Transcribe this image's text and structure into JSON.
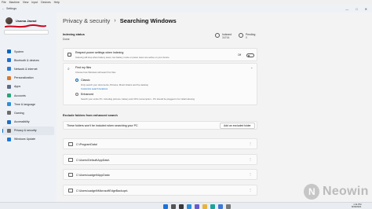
{
  "vm_menu": [
    "File",
    "Machine",
    "View",
    "Input",
    "Devices",
    "Help"
  ],
  "window": {
    "title": "Settings",
    "back_icon": "arrow-left-icon",
    "minimize": "—",
    "maximize": "□",
    "close": "✕"
  },
  "user": {
    "name": "Usama Jawad"
  },
  "sidebar": {
    "items": [
      {
        "label": "System",
        "icon": "monitor-icon",
        "color": "#0067c0"
      },
      {
        "label": "Bluetooth & devices",
        "icon": "bluetooth-icon",
        "color": "#1f6fd1"
      },
      {
        "label": "Network & internet",
        "icon": "network-icon",
        "color": "#2b7ad8"
      },
      {
        "label": "Personalization",
        "icon": "brush-icon",
        "color": "#d9782d"
      },
      {
        "label": "Apps",
        "icon": "apps-icon",
        "color": "#5b6b8a"
      },
      {
        "label": "Accounts",
        "icon": "person-icon",
        "color": "#2aa37a"
      },
      {
        "label": "Time & language",
        "icon": "globe-icon",
        "color": "#2d8fd8"
      },
      {
        "label": "Gaming",
        "icon": "gamepad-icon",
        "color": "#6c6c6c"
      },
      {
        "label": "Accessibility",
        "icon": "accessibility-icon",
        "color": "#1d6fc7"
      },
      {
        "label": "Privacy & security",
        "icon": "shield-icon",
        "color": "#6c6c6c",
        "active": true
      },
      {
        "label": "Windows Update",
        "icon": "update-icon",
        "color": "#1f79d4"
      }
    ]
  },
  "breadcrumb": {
    "parent": "Privacy & security",
    "separator": "›",
    "current": "Searching Windows"
  },
  "indexing": {
    "heading": "Indexing status",
    "status": "Done",
    "indexed_label": "Indexed",
    "indexed_value": "34744",
    "pending_label": "Pending",
    "pending_value": "0"
  },
  "respect_power": {
    "title": "Respect power settings when indexing",
    "desc": "Indexing will stop when battery saver, low battery mode or power saver are active on your device",
    "state": "Off"
  },
  "find_files": {
    "title": "Find my files",
    "desc": "Choose how Windows will search for files",
    "classic_title": "Classic",
    "classic_desc": "Only search your documents, Pictures, Music folders and the desktop",
    "classic_link": "Customize search locations",
    "enhanced_title": "Enhanced",
    "enhanced_desc": "Search your entire PC, including pictures, battery and CPU consumption - PC should be plugged in for initial indexing"
  },
  "exclude": {
    "heading": "Exclude folders from enhanced search",
    "desc": "These folders won't be included when searching your PC",
    "add_button": "Add an excluded folder",
    "folders": [
      "C:\\ProgramData\\",
      "C:\\Users\\Default\\AppData\\",
      "C:\\Users\\uadgeit\\AppData\\",
      "C:\\Users\\uadgeit\\MicrosoftEdgeBackups\\"
    ]
  },
  "taskbar": {
    "time": "1:11 PM",
    "date": "8/29/2021"
  },
  "watermark": {
    "text": "Neowin"
  }
}
